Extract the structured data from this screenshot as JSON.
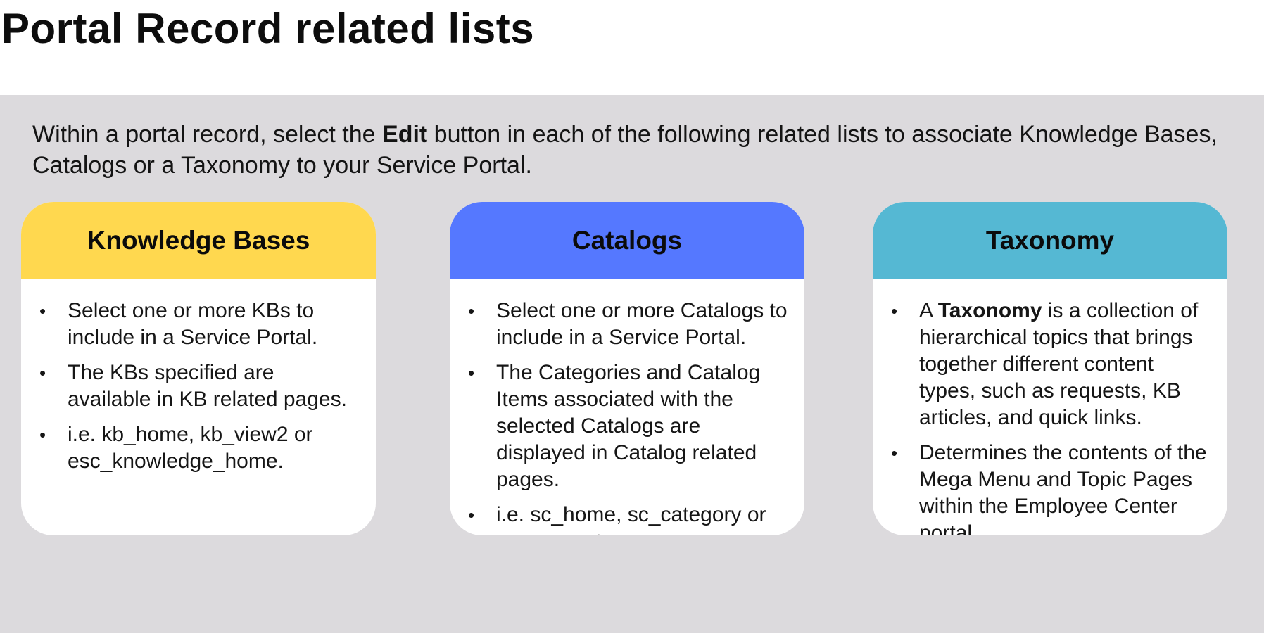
{
  "title": "Portal Record related lists",
  "intro": {
    "before": "Within a portal record, select the ",
    "bold": "Edit",
    "after": " button in each of the following related lists to associate Knowledge Bases, Catalogs or a Taxonomy to your Service Portal."
  },
  "colors": {
    "knowledge_bases": "#ffd84f",
    "catalogs": "#5578ff",
    "taxonomy": "#55b8d3",
    "panel_background": "#dcdadd"
  },
  "cards": [
    {
      "title": "Knowledge Bases",
      "bullets": [
        "Select one or more KBs to include in a Service Portal.",
        "The KBs specified are available in KB related pages.",
        "i.e. kb_home, kb_view2 or esc_knowledge_home."
      ]
    },
    {
      "title": "Catalogs",
      "bullets": [
        "Select one or more Catalogs to include in a Service Portal.",
        "The Categories and Catalog Items associated with the selected Catalogs are displayed in Catalog related pages.",
        "i.e. sc_home, sc_category or esc_sc_category."
      ]
    },
    {
      "title": "Taxonomy",
      "bullet1": {
        "before": "A ",
        "bold": "Taxonomy",
        "after": " is a collection of hierarchical topics that brings together different content types, such as requests, KB articles, and quick links."
      },
      "bullets": [
        "Determines the contents of the Mega Menu and Topic Pages within the Employee Center portal."
      ]
    }
  ]
}
